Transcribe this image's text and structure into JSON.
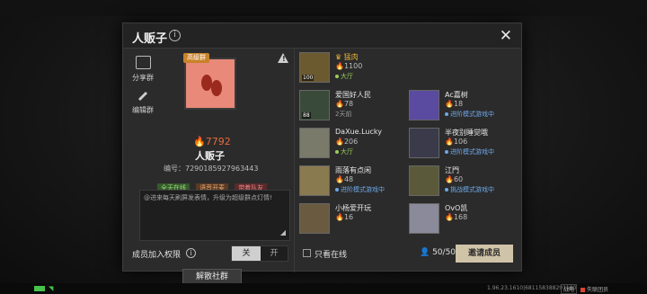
{
  "window": {
    "title": "人贩子",
    "close": "✕"
  },
  "left": {
    "share_label": "分享群",
    "edit_label": "编辑群",
    "group_badge": "高级群",
    "score": "7792",
    "group_name": "人贩子",
    "id_text": "编号：7290185927963443",
    "tags": [
      "全天在线",
      "语音开麦",
      "带着队友"
    ],
    "notice": "@进来每天刷屏发表情，升级为超级群点灯情!",
    "permission_label": "成员加入权限",
    "toggle_off": "关",
    "toggle_on": "开",
    "dissolve_label": "解散社群"
  },
  "members": [
    {
      "name": "猛肉",
      "score": "1100",
      "status": "大厅",
      "status_type": "green",
      "level": "100",
      "gold": true,
      "crown": true
    },
    {
      "name": "爱国好人民",
      "score": "78",
      "status": "2天前",
      "status_type": "grey",
      "level": "88",
      "gold": false,
      "crown": false
    },
    {
      "name": "Ac嘉树",
      "score": "18",
      "status": "进阶模式游戏中",
      "status_type": "blue",
      "level": "",
      "gold": false,
      "crown": false
    },
    {
      "name": "DaXue.Lucky",
      "score": "206",
      "status": "大厅",
      "status_type": "green",
      "level": "",
      "gold": false,
      "crown": false
    },
    {
      "name": "半夜别睡觉哦",
      "score": "106",
      "status": "进阶模式游戏中",
      "status_type": "blue",
      "level": "",
      "gold": false,
      "crown": false
    },
    {
      "name": "雨落有点闲",
      "score": "48",
      "status": "进阶模式游戏中",
      "status_type": "blue",
      "level": "",
      "gold": false,
      "crown": false
    },
    {
      "name": "江門",
      "score": "60",
      "status": "挑战模式游戏中",
      "status_type": "blue",
      "level": "",
      "gold": false,
      "crown": false
    },
    {
      "name": "小杨爱开玩",
      "score": "16",
      "status": "",
      "status_type": "grey",
      "level": "",
      "gold": false,
      "crown": false
    },
    {
      "name": "OvO凯",
      "score": "168",
      "status": "",
      "status_type": "grey",
      "level": "",
      "gold": false,
      "crown": false
    }
  ],
  "footer": {
    "online_only": "只看在线",
    "member_count": "50/50",
    "invite_label": "邀请成员"
  },
  "statusbar": {
    "version": "1.96.23.1610|681158388291180",
    "button": "战略",
    "right_label": "失联团员"
  }
}
